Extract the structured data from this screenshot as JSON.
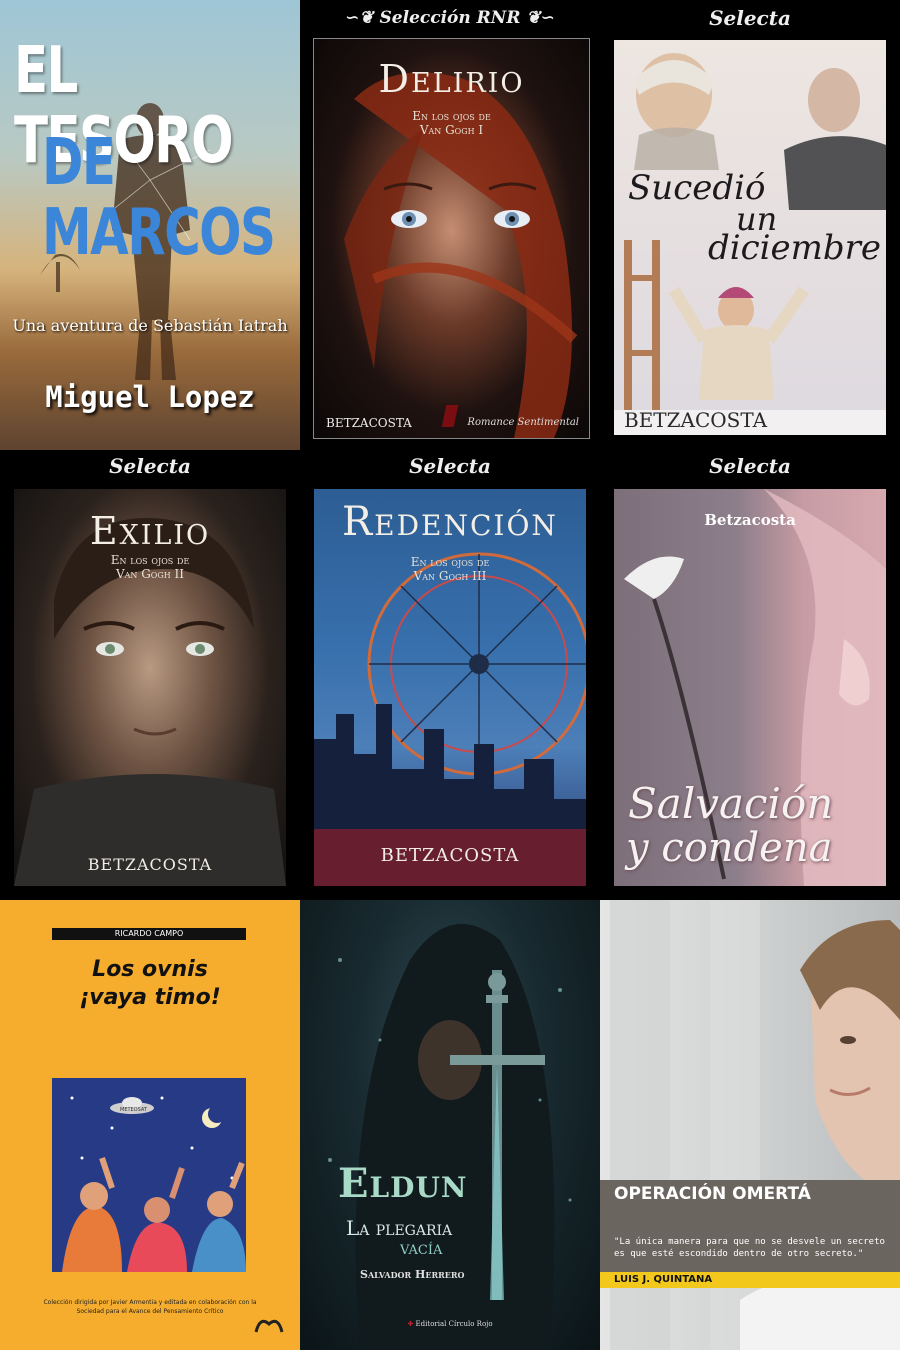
{
  "books": {
    "tesoro": {
      "title_line1": "EL TESORO",
      "title_line2": "DE MARCOS",
      "subtitle": "Una aventura de Sebastián Iatrah",
      "author": "Miguel Lopez"
    },
    "delirio": {
      "series": "Selección RNR",
      "title": "Delirio",
      "subtitle_line1": "En los ojos de",
      "subtitle_line2": "Van Gogh I",
      "author": "BETZACOSTA",
      "imprint": "Romance Sentimental"
    },
    "diciembre": {
      "series": "Selecta",
      "title_line1": "Sucedió",
      "title_line2": "un",
      "title_line3": "diciembre",
      "author": "BETZACOSTA"
    },
    "exilio": {
      "series": "Selecta",
      "title": "Exilio",
      "subtitle_line1": "En los ojos de",
      "subtitle_line2": "Van Gogh II",
      "author": "BETZACOSTA"
    },
    "redencion": {
      "series": "Selecta",
      "title": "Redención",
      "subtitle_line1": "En los ojos de",
      "subtitle_line2": "Van Gogh III",
      "author": "BETZACOSTA"
    },
    "salvacion": {
      "series": "Selecta",
      "author": "Betzacosta",
      "title_line1": "Salvación",
      "title_line2": "y condena"
    },
    "ovnis": {
      "author": "RICARDO CAMPO",
      "title_line1": "Los ovnis",
      "title_line2": "¡vaya timo!",
      "footer_line1": "Colección dirigida por Javier Armentia y editada en colaboración con la",
      "footer_line2": "Sociedad para el Avance del Pensamiento Crítico",
      "ufo_label": "METEOSAT"
    },
    "eldun": {
      "title_line1": "Eldun",
      "title_line2": "La plegaria",
      "title_line3": "vacía",
      "author": "Salvador Herrero",
      "publisher": "Editorial Círculo Rojo"
    },
    "omerta": {
      "title": "OPERACIÓN OMERTÁ",
      "quote_line1": "\"La única manera para que no se desvele un secreto",
      "quote_line2": "es que esté escondido dentro de otro secreto.\"",
      "author": "LUIS J. QUINTANA"
    }
  },
  "colors": {
    "ovnis_yellow": "#f6ad2d",
    "omerta_band": "#6b6560",
    "omerta_author_band": "#f2c81c"
  }
}
